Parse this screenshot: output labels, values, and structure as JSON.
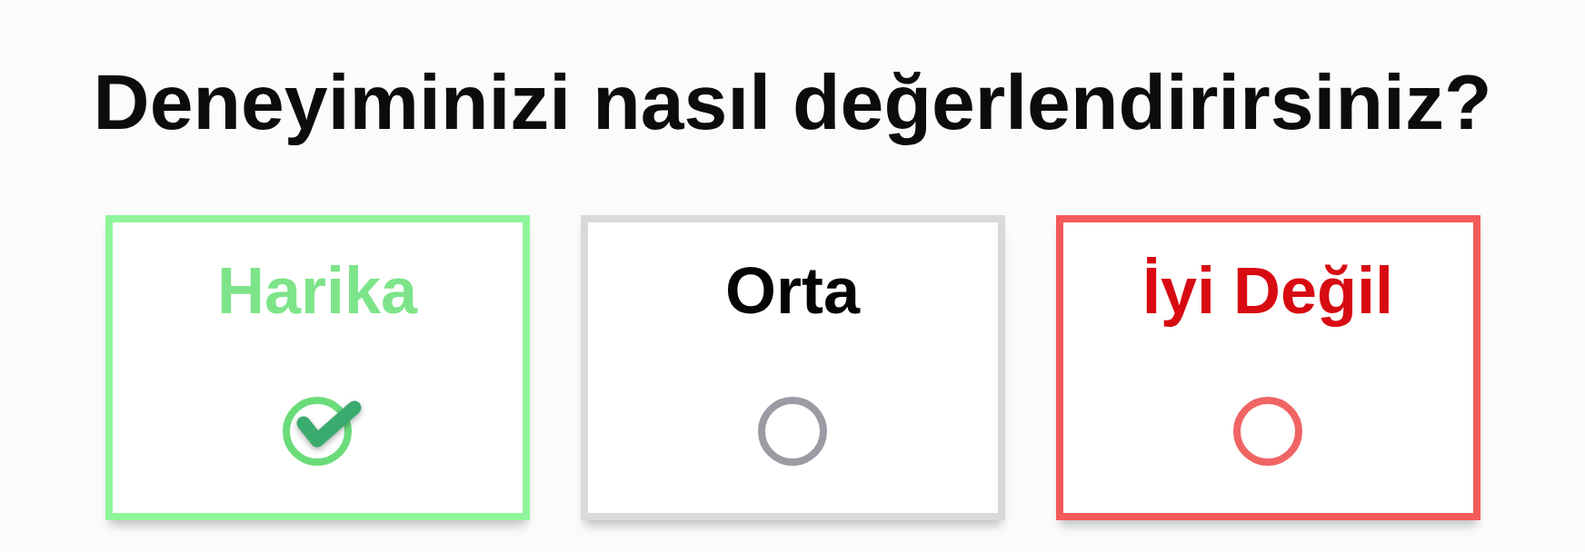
{
  "question": "Deneyiminizi nasıl değerlendirirsiniz?",
  "options": [
    {
      "label": "Harika",
      "kind": "positive",
      "selected": true,
      "color": "#6bdc7a"
    },
    {
      "label": "Orta",
      "kind": "neutral",
      "selected": false,
      "color": "#9a9ba3"
    },
    {
      "label": "İyi Değil",
      "kind": "negative",
      "selected": false,
      "color": "#f06464"
    }
  ]
}
